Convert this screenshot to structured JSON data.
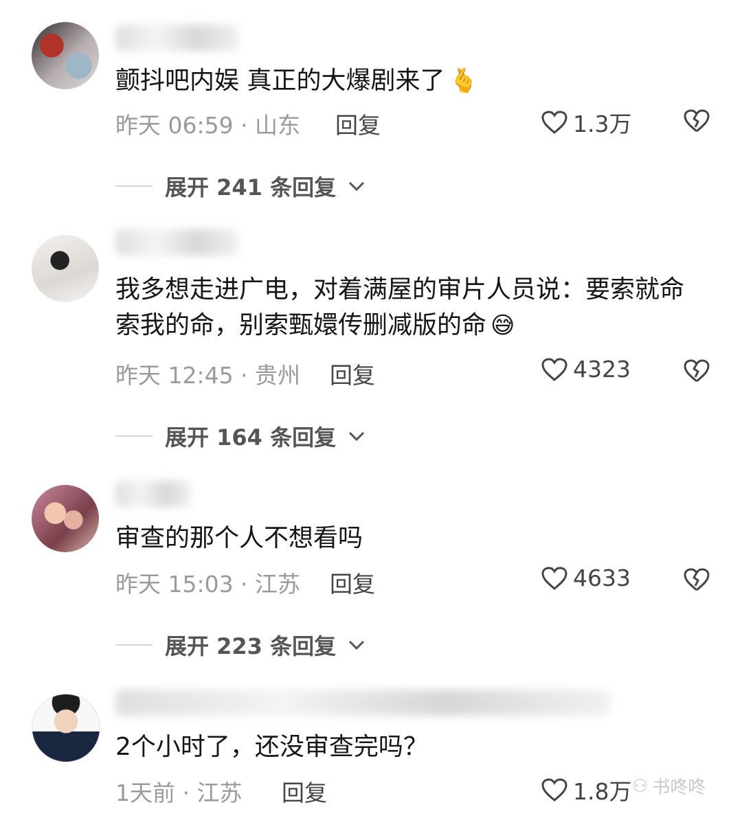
{
  "comments": [
    {
      "avatar_icon": "user-avatar",
      "text": "颤抖吧内娱 真正的大爆剧来了",
      "emoji": "🫰",
      "meta": "昨天 06:59 · 山东",
      "reply_label": "回复",
      "likes": "1.3万",
      "expand_label": "展开 241 条回复"
    },
    {
      "avatar_icon": "user-avatar",
      "text": "我多想走进广电，对着满屋的审片人员说：要索就命索我的命，别索甄嬛传删减版的命",
      "emoji": "😅",
      "meta": "昨天 12:45 · 贵州",
      "reply_label": "回复",
      "likes": "4323",
      "expand_label": "展开 164 条回复"
    },
    {
      "avatar_icon": "user-avatar",
      "text": "审查的那个人不想看吗",
      "emoji": "",
      "meta": "昨天 15:03 · 江苏",
      "reply_label": "回复",
      "likes": "4633",
      "expand_label": "展开 223 条回复"
    },
    {
      "avatar_icon": "user-avatar",
      "text": "2个小时了，还没审查完吗？",
      "emoji": "",
      "meta": "1天前 · 江苏",
      "reply_label": "回复",
      "likes": "1.8万",
      "expand_label": ""
    }
  ],
  "watermark": "书咚咚",
  "colors": {
    "text": "#161616",
    "meta": "#9a9a9a",
    "accent_heart": "#e8587a"
  }
}
